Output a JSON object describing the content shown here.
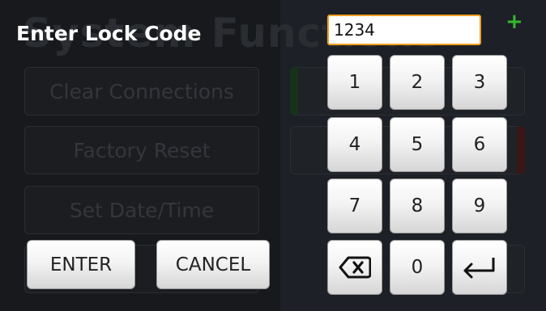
{
  "dialog": {
    "title": "Enter Lock Code",
    "code_value": "1234",
    "add_icon": "plus-icon",
    "enter_label": "ENTER",
    "cancel_label": "CANCEL"
  },
  "keypad": {
    "keys": [
      "1",
      "2",
      "3",
      "4",
      "5",
      "6",
      "7",
      "8",
      "9",
      "0"
    ],
    "backspace_icon": "backspace-icon",
    "return_icon": "return-icon"
  },
  "background": {
    "title": "System Functions",
    "buttons": [
      "Clear Connections",
      "Factory Reset",
      "Set Date/Time"
    ]
  },
  "colors": {
    "input_border": "#f0a020",
    "plus_icon": "#35b82e",
    "title_text": "#ffffff",
    "key_face": "#f3f3f3"
  }
}
